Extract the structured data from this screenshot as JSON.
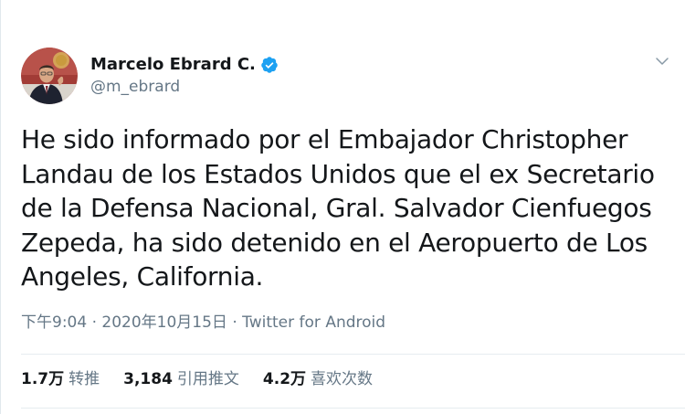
{
  "author": {
    "display_name": "Marcelo Ebrard C.",
    "handle": "@m_ebrard",
    "verified": true,
    "avatar_icon": "person-avatar-icon",
    "verified_icon": "verified-badge-icon"
  },
  "menu_icon": "chevron-down-icon",
  "tweet": {
    "text": "He sido informado por el Embajador Christopher Landau de los Estados Unidos que el ex Secretario de la Defensa Nacional, Gral. Salvador Cienfuegos Zepeda, ha sido detenido en el Aeropuerto de Los Angeles, California.",
    "time": "下午9:04",
    "separator1": " · ",
    "date": "2020年10月15日",
    "separator2": " · ",
    "source": "Twitter for Android"
  },
  "stats": {
    "retweets_count": "1.7万",
    "retweets_label": "转推",
    "quotes_count": "3,184",
    "quotes_label": "引用推文",
    "likes_count": "4.2万",
    "likes_label": "喜欢次数"
  },
  "colors": {
    "accent": "#1da1f2",
    "text_primary": "#14171a",
    "text_secondary": "#657786",
    "divider": "#e6ecf0"
  }
}
